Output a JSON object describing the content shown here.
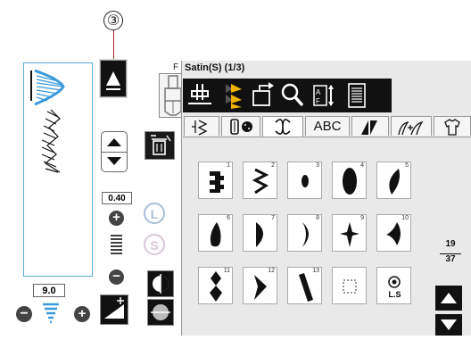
{
  "callout_number": "③",
  "presser_foot": {
    "label": "F"
  },
  "width": {
    "value": "9.0"
  },
  "length": {
    "value": "0.40"
  },
  "buttons": {
    "L": "L",
    "S": "S"
  },
  "panel": {
    "title": "Satin(S) (1/3)"
  },
  "tabs": [
    {
      "label": "",
      "icon": "utility-stitch-icon"
    },
    {
      "label": "",
      "icon": "buttonhole-icon"
    },
    {
      "label": "",
      "icon": "decorative-stitch-icon",
      "active": true
    },
    {
      "label": "ABC",
      "icon": "alphabet-tab"
    },
    {
      "label": "",
      "icon": "quilt-stitch-icon"
    },
    {
      "label": "",
      "icon": "heirloom-stitch-icon"
    },
    {
      "label": "",
      "icon": "garment-icon"
    }
  ],
  "stitches": [
    {
      "n": "1",
      "icon": "satin-block-icon"
    },
    {
      "n": "2",
      "icon": "satin-zigzag-icon"
    },
    {
      "n": "3",
      "icon": "satin-dot-icon"
    },
    {
      "n": "4",
      "icon": "satin-oval-icon"
    },
    {
      "n": "5",
      "icon": "satin-leaf-icon"
    },
    {
      "n": "6",
      "icon": "satin-teardrop-icon"
    },
    {
      "n": "7",
      "icon": "satin-half-moon-icon"
    },
    {
      "n": "8",
      "icon": "satin-crescent-icon"
    },
    {
      "n": "9",
      "icon": "satin-star-icon"
    },
    {
      "n": "10",
      "icon": "satin-wing-icon"
    },
    {
      "n": "11",
      "icon": "satin-diamond-chain-icon"
    },
    {
      "n": "12",
      "icon": "satin-chevron-icon"
    },
    {
      "n": "13",
      "icon": "satin-slant-bar-icon"
    },
    {
      "n": "",
      "icon": "empty-slot-icon"
    },
    {
      "n": "",
      "icon": "ls-stitch-icon",
      "label": "L.S"
    }
  ],
  "pagination": {
    "current": "19",
    "total": "37"
  },
  "colors": {
    "accent_blue": "#3a9ad9",
    "panel_bg": "#e9e9e9"
  }
}
